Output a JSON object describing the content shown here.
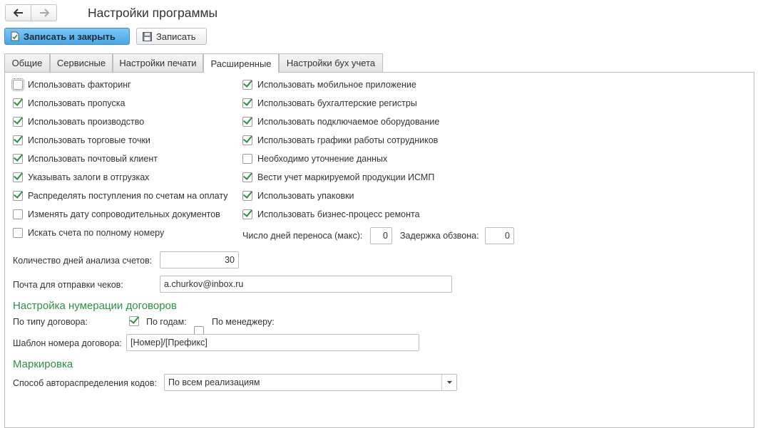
{
  "window": {
    "title": "Настройки программы"
  },
  "toolbar": {
    "save_close_label": "Записать и закрыть",
    "save_label": "Записать"
  },
  "tabs": [
    {
      "label": "Общие",
      "active": false
    },
    {
      "label": "Сервисные",
      "active": false
    },
    {
      "label": "Настройки печати",
      "active": false
    },
    {
      "label": "Расширенные",
      "active": true
    },
    {
      "label": "Настройки бух учета",
      "active": false
    }
  ],
  "left_checkboxes": [
    {
      "label": "Использовать факторинг",
      "checked": false
    },
    {
      "label": "Использовать пропуска",
      "checked": true
    },
    {
      "label": "Использовать производство",
      "checked": true
    },
    {
      "label": "Использовать торговые точки",
      "checked": true
    },
    {
      "label": "Использовать почтовый клиент",
      "checked": true
    },
    {
      "label": "Указывать залоги в отгрузках",
      "checked": true
    },
    {
      "label": "Распределять поступления по счетам на оплату",
      "checked": true
    },
    {
      "label": "Изменять дату сопроводительных документов",
      "checked": false
    },
    {
      "label": "Искать счета по полному номеру",
      "checked": false
    }
  ],
  "right_checkboxes": [
    {
      "label": "Использовать мобильное приложение",
      "checked": true
    },
    {
      "label": "Использовать бухгалтерские регистры",
      "checked": true
    },
    {
      "label": "Использовать подключаемое оборудование",
      "checked": true
    },
    {
      "label": "Использовать графики работы сотрудников",
      "checked": true
    },
    {
      "label": "Необходимо уточнение данных",
      "checked": false
    },
    {
      "label": "Вести учет маркируемой продукции ИСМП",
      "checked": true
    },
    {
      "label": "Использовать упаковки",
      "checked": true
    },
    {
      "label": "Использовать бизнес-процесс ремонта",
      "checked": true
    }
  ],
  "transfer_days": {
    "label": "Число дней переноса (макс):",
    "value": "0"
  },
  "call_delay": {
    "label": "Задержка обзвона:",
    "value": "0"
  },
  "analysis_days": {
    "label": "Количество дней анализа счетов:",
    "value": "30"
  },
  "receipt_email": {
    "label": "Почта для отправки чеков:",
    "value": "a.churkov@inbox.ru"
  },
  "numbering": {
    "heading": "Настройка нумерации договоров",
    "by_type_label": "По типу договора:",
    "by_type_checked": true,
    "by_years_label": "По годам:",
    "by_years_checked": false,
    "by_manager_label": "По менеджеру:",
    "by_manager_checked": false,
    "template_label": "Шаблон номера договора:",
    "template_value": "[Номер]/[Префикс]"
  },
  "marking": {
    "heading": "Маркировка",
    "method_label": "Способ автораспределения кодов:",
    "method_value": "По всем реализациям"
  }
}
